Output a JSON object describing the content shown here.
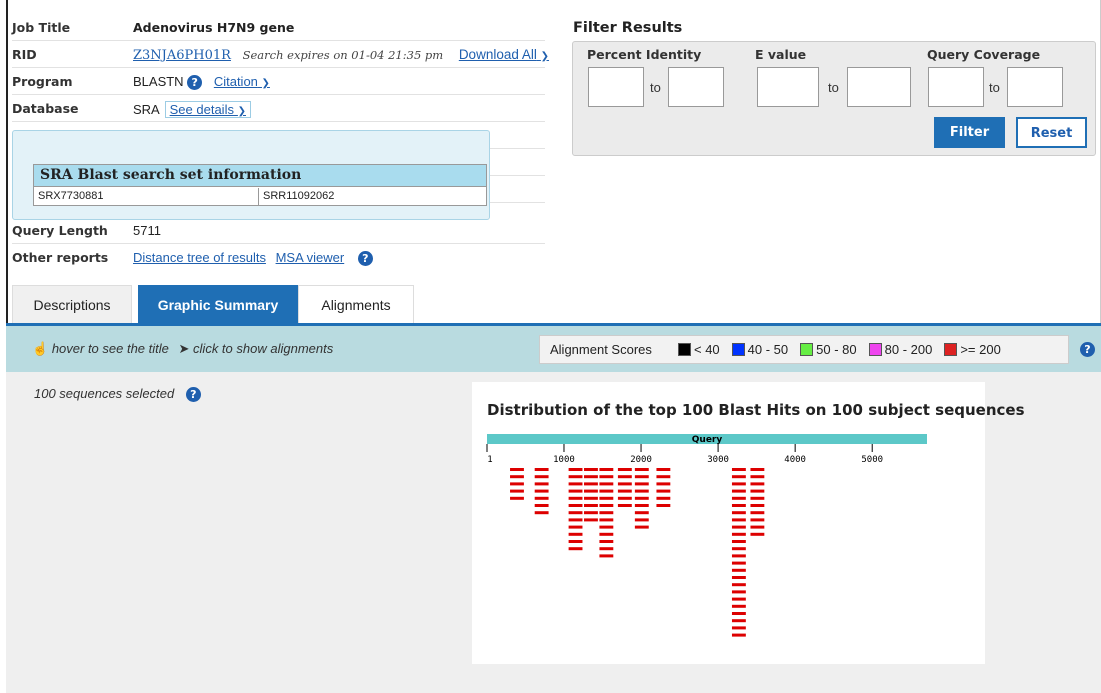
{
  "info": {
    "job_title_label": "Job Title",
    "job_title_value": "Adenovirus H7N9 gene",
    "rid_label": "RID",
    "rid_value": "Z3NJA6PH01R",
    "search_expires": "Search expires on 01-04 21:35 pm",
    "download_all": "Download All",
    "program_label": "Program",
    "program_value": "BLASTN",
    "citation": "Citation",
    "database_label": "Database",
    "database_value": "SRA",
    "see_details": "See details",
    "query_length_label": "Query Length",
    "query_length_value": "5711",
    "other_reports_label": "Other reports",
    "distance_tree": "Distance tree of results",
    "msa_viewer": "MSA viewer"
  },
  "popup": {
    "title": "SRA Blast search set information",
    "cell1": "SRX7730881",
    "cell2": "SRR11092062"
  },
  "filter": {
    "title": "Filter Results",
    "percent_identity": "Percent Identity",
    "e_value": "E value",
    "query_coverage": "Query Coverage",
    "to": "to",
    "filter_button": "Filter",
    "reset_button": "Reset"
  },
  "tabs": [
    "Descriptions",
    "Graphic Summary",
    "Alignments"
  ],
  "toolbar": {
    "hover_hint": "hover to see the title",
    "click_hint": "click to show alignments",
    "scores_label": "Alignment Scores",
    "legend": [
      {
        "label": "< 40",
        "color": "#000000"
      },
      {
        "label": "40 - 50",
        "color": "#0033ff"
      },
      {
        "label": "50 - 80",
        "color": "#66ee44"
      },
      {
        "label": "80 - 200",
        "color": "#ee44ee"
      },
      {
        "label": ">= 200",
        "color": "#dd2222"
      }
    ]
  },
  "main": {
    "sequences_selected": "100 sequences selected"
  },
  "graphic": {
    "title": "Distribution of the top 100 Blast Hits on 100 subject sequences",
    "query_label": "Query",
    "query_length": 5711,
    "ticks": [
      1,
      1000,
      2000,
      3000,
      4000,
      5000
    ],
    "hit_color": "#dd0000",
    "hits": [
      [
        1,
        1
      ],
      [
        1,
        1
      ],
      [
        1,
        1
      ],
      [
        1,
        1
      ],
      [
        1,
        1
      ],
      [
        2,
        1
      ],
      [
        2,
        1
      ],
      [
        2,
        1
      ],
      [
        2,
        1
      ],
      [
        2,
        1
      ],
      [
        2,
        1
      ],
      [
        2,
        1
      ],
      [
        3,
        1
      ],
      [
        3,
        1
      ],
      [
        3,
        1
      ],
      [
        3,
        1
      ],
      [
        3,
        1
      ],
      [
        3,
        1
      ],
      [
        3,
        1
      ],
      [
        3,
        1
      ],
      [
        3,
        1
      ],
      [
        3,
        1
      ],
      [
        3,
        1
      ],
      [
        3,
        1
      ],
      [
        4,
        1
      ],
      [
        4,
        1
      ],
      [
        4,
        1
      ],
      [
        4,
        1
      ],
      [
        4,
        1
      ],
      [
        4,
        1
      ],
      [
        4,
        1
      ],
      [
        4,
        1
      ],
      [
        5,
        1
      ],
      [
        5,
        1
      ],
      [
        5,
        1
      ],
      [
        5,
        1
      ],
      [
        5,
        1
      ],
      [
        5,
        1
      ],
      [
        5,
        1
      ],
      [
        5,
        1
      ],
      [
        5,
        1
      ],
      [
        5,
        1
      ],
      [
        5,
        1
      ],
      [
        5,
        1
      ],
      [
        5,
        1
      ],
      [
        6,
        1
      ],
      [
        6,
        1
      ],
      [
        6,
        1
      ],
      [
        6,
        1
      ],
      [
        6,
        1
      ],
      [
        6,
        1
      ],
      [
        7,
        1
      ],
      [
        7,
        1
      ],
      [
        7,
        1
      ],
      [
        7,
        1
      ],
      [
        7,
        1
      ],
      [
        7,
        1
      ],
      [
        7,
        1
      ],
      [
        7,
        1
      ],
      [
        7,
        1
      ],
      [
        8,
        1
      ],
      [
        8,
        1
      ],
      [
        8,
        1
      ],
      [
        8,
        1
      ],
      [
        8,
        1
      ],
      [
        8,
        1
      ],
      [
        9,
        1
      ],
      [
        9,
        1
      ],
      [
        9,
        1
      ],
      [
        9,
        1
      ],
      [
        9,
        1
      ],
      [
        9,
        1
      ],
      [
        9,
        1
      ],
      [
        9,
        1
      ],
      [
        9,
        1
      ],
      [
        9,
        1
      ],
      [
        9,
        1
      ],
      [
        9,
        1
      ],
      [
        9,
        1
      ],
      [
        9,
        1
      ],
      [
        9,
        1
      ],
      [
        9,
        1
      ],
      [
        9,
        1
      ],
      [
        9,
        1
      ],
      [
        9,
        1
      ],
      [
        9,
        1
      ],
      [
        9,
        1
      ],
      [
        9,
        1
      ],
      [
        9,
        1
      ],
      [
        9,
        1
      ],
      [
        10,
        1
      ],
      [
        10,
        1
      ],
      [
        10,
        1
      ],
      [
        10,
        1
      ],
      [
        10,
        1
      ],
      [
        10,
        1
      ],
      [
        10,
        1
      ],
      [
        10,
        1
      ],
      [
        10,
        1
      ],
      [
        10,
        1
      ]
    ]
  }
}
